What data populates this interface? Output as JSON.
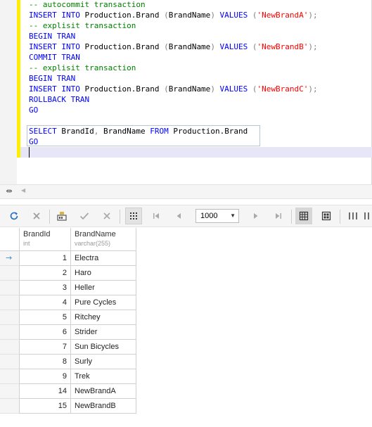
{
  "editor": {
    "lines": [
      [
        {
          "t": "-- autocommit transaction",
          "c": "cm"
        }
      ],
      [
        {
          "t": "INSERT INTO",
          "c": "kw"
        },
        {
          "t": " Production.Brand ",
          "c": "id"
        },
        {
          "t": "(",
          "c": "op"
        },
        {
          "t": "BrandName",
          "c": "id"
        },
        {
          "t": ")",
          "c": "op"
        },
        {
          "t": " VALUES ",
          "c": "kw"
        },
        {
          "t": "(",
          "c": "op"
        },
        {
          "t": "'NewBrandA'",
          "c": "st"
        },
        {
          "t": ");",
          "c": "op"
        }
      ],
      [
        {
          "t": "-- explisit transaction",
          "c": "cm"
        }
      ],
      [
        {
          "t": "BEGIN TRAN",
          "c": "kw"
        }
      ],
      [
        {
          "t": "INSERT INTO",
          "c": "kw"
        },
        {
          "t": " Production.Brand ",
          "c": "id"
        },
        {
          "t": "(",
          "c": "op"
        },
        {
          "t": "BrandName",
          "c": "id"
        },
        {
          "t": ")",
          "c": "op"
        },
        {
          "t": " VALUES ",
          "c": "kw"
        },
        {
          "t": "(",
          "c": "op"
        },
        {
          "t": "'NewBrandB'",
          "c": "st"
        },
        {
          "t": ");",
          "c": "op"
        }
      ],
      [
        {
          "t": "COMMIT TRAN",
          "c": "kw"
        }
      ],
      [
        {
          "t": "-- explisit transaction",
          "c": "cm"
        }
      ],
      [
        {
          "t": "BEGIN TRAN",
          "c": "kw"
        }
      ],
      [
        {
          "t": "INSERT INTO",
          "c": "kw"
        },
        {
          "t": " Production.Brand ",
          "c": "id"
        },
        {
          "t": "(",
          "c": "op"
        },
        {
          "t": "BrandName",
          "c": "id"
        },
        {
          "t": ")",
          "c": "op"
        },
        {
          "t": " VALUES ",
          "c": "kw"
        },
        {
          "t": "(",
          "c": "op"
        },
        {
          "t": "'NewBrandC'",
          "c": "st"
        },
        {
          "t": ");",
          "c": "op"
        }
      ],
      [
        {
          "t": "ROLLBACK TRAN",
          "c": "kw"
        }
      ],
      [
        {
          "t": "GO",
          "c": "kw"
        }
      ],
      [],
      [
        {
          "t": "SELECT",
          "c": "kw"
        },
        {
          "t": " BrandId",
          "c": "id"
        },
        {
          "t": ",",
          "c": "op"
        },
        {
          "t": " BrandName ",
          "c": "id"
        },
        {
          "t": "FROM",
          "c": "kw"
        },
        {
          "t": " Production.Brand",
          "c": "id"
        }
      ],
      [
        {
          "t": "GO",
          "c": "kw"
        }
      ]
    ]
  },
  "toolbar": {
    "page_size": "1000",
    "icons": [
      "refresh-icon",
      "cancel-icon",
      "load-icon",
      "apply-icon",
      "discard-icon",
      "grid-view-icon",
      "first-page-icon",
      "previous-page-icon",
      "next-page-icon",
      "last-page-icon",
      "grid-mode-icon",
      "form-mode-icon",
      "columns-icon"
    ]
  },
  "grid": {
    "columns": [
      {
        "name": "BrandId",
        "type": "int"
      },
      {
        "name": "BrandName",
        "type": "varchar(255)"
      }
    ],
    "rows": [
      [
        "1",
        "Electra"
      ],
      [
        "2",
        "Haro"
      ],
      [
        "3",
        "Heller"
      ],
      [
        "4",
        "Pure Cycles"
      ],
      [
        "5",
        "Ritchey"
      ],
      [
        "6",
        "Strider"
      ],
      [
        "7",
        "Sun Bicycles"
      ],
      [
        "8",
        "Surly"
      ],
      [
        "9",
        "Trek"
      ],
      [
        "14",
        "NewBrandA"
      ],
      [
        "15",
        "NewBrandB"
      ]
    ],
    "current_row": 0
  },
  "colors": {
    "change_bar": "#ffee00",
    "keyword": "#0000ff",
    "comment": "#008000",
    "string": "#ff0000",
    "row_arrow": "#3b8fd9"
  }
}
